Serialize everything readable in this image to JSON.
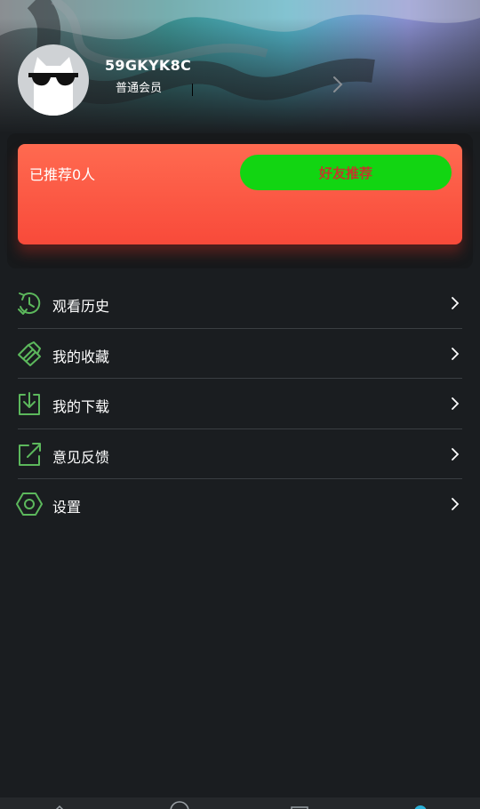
{
  "profile": {
    "username": "59GKYK8C",
    "level": "普通会员"
  },
  "referral": {
    "count_text": "已推荐0人",
    "invite_button": "好友推荐"
  },
  "menu": [
    {
      "label": "观看历史",
      "icon": "history-icon"
    },
    {
      "label": "我的收藏",
      "icon": "favorites-icon"
    },
    {
      "label": "我的下载",
      "icon": "download-icon"
    },
    {
      "label": "意见反馈",
      "icon": "feedback-icon"
    },
    {
      "label": "设置",
      "icon": "settings-icon"
    }
  ],
  "colors": {
    "background": "#1a1d20",
    "accent_green": "#5cb85c",
    "card_red": "#f84a3a",
    "button_green": "#12d512",
    "button_text": "#c0392b"
  }
}
